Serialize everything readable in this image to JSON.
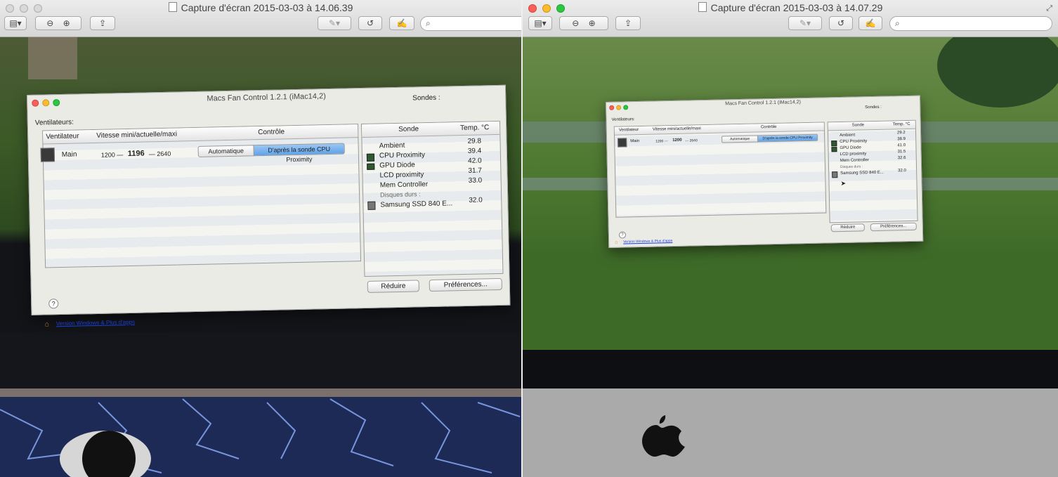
{
  "left_window": {
    "title": "Capture d'écran 2015-03-03 à 14.06.39",
    "search_placeholder": "",
    "app": {
      "title": "Macs Fan Control 1.2.1 (iMac14,2)",
      "fans_label": "Ventilateurs:",
      "probes_label": "Sondes :",
      "fan_headers": [
        "Ventilateur",
        "Vitesse mini/actuelle/maxi",
        "Contrôle"
      ],
      "fan": {
        "name": "Main",
        "min": "1200 —",
        "current": "1196",
        "max": "— 2640"
      },
      "control_auto": "Automatique",
      "control_sensor": "D'après la sonde CPU Proximity",
      "probe_headers": [
        "Sonde",
        "Temp. °C"
      ],
      "probes": [
        {
          "name": "Ambient",
          "temp": "29.8"
        },
        {
          "name": "CPU Proximity",
          "temp": "39.4"
        },
        {
          "name": "GPU Diode",
          "temp": "42.0"
        },
        {
          "name": "LCD proximity",
          "temp": "31.7"
        },
        {
          "name": "Mem Controller",
          "temp": "33.0"
        }
      ],
      "disks_label": "Disques durs :",
      "disk": {
        "name": "Samsung SSD 840 E...",
        "temp": "32.0"
      },
      "reduce_button": "Réduire",
      "prefs_button": "Préférences...",
      "help": "?",
      "link": "Version Windows & Plus d'apps"
    }
  },
  "right_window": {
    "title": "Capture d'écran 2015-03-03 à 14.07.29",
    "search_placeholder": "",
    "app": {
      "title": "Macs Fan Control 1.2.1 (iMac14,2)",
      "fans_label": "Ventilateurs:",
      "probes_label": "Sondes :",
      "fan_headers": [
        "Ventilateur",
        "Vitesse mini/actuelle/maxi",
        "Contrôle"
      ],
      "fan": {
        "name": "Main",
        "min": "1200 —",
        "current": "1200",
        "max": "— 2640"
      },
      "control_auto": "Automatique",
      "control_sensor": "D'après la sonde CPU Proximity",
      "probe_headers": [
        "Sonde",
        "Temp. °C"
      ],
      "probes": [
        {
          "name": "Ambient",
          "temp": "29.2"
        },
        {
          "name": "CPU Proximity",
          "temp": "38.9"
        },
        {
          "name": "GPU Diode",
          "temp": "41.0"
        },
        {
          "name": "LCD proximity",
          "temp": "31.5"
        },
        {
          "name": "Mem Controller",
          "temp": "32.6"
        }
      ],
      "disks_label": "Disques durs :",
      "disk": {
        "name": "Samsung SSD 840 E...",
        "temp": "32.0"
      },
      "reduce_button": "Réduire",
      "prefs_button": "Préférences...",
      "help": "?",
      "link": "Version Windows & Plus d'apps"
    }
  },
  "colors": {
    "close": "#fc5f57",
    "minimize": "#fdbc2e",
    "zoom": "#29c840",
    "link": "#1d3fd6",
    "selected_segment": "#6aa9ea"
  }
}
